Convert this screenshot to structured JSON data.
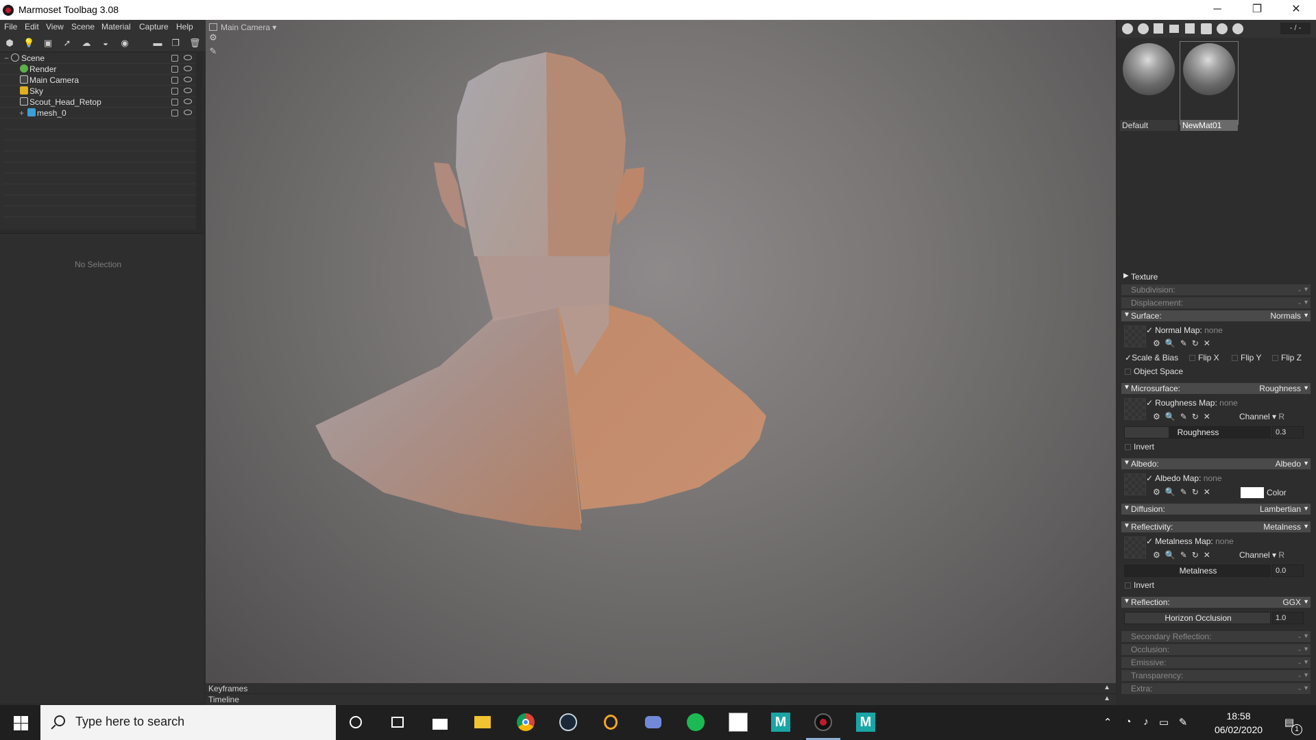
{
  "window": {
    "title": "Marmoset Toolbag 3.08",
    "minimize": "─",
    "maximize": "❐",
    "close": "✕"
  },
  "menu": [
    "File",
    "Edit",
    "View",
    "Scene",
    "Material",
    "Capture",
    "Help"
  ],
  "outliner": {
    "items": [
      {
        "label": "Scene",
        "expander": "−"
      },
      {
        "label": "Render"
      },
      {
        "label": "Main Camera"
      },
      {
        "label": "Sky"
      },
      {
        "label": "Scout_Head_Retop"
      },
      {
        "label": "mesh_0",
        "expander": "+"
      }
    ]
  },
  "properties": {
    "empty_text": "No Selection"
  },
  "viewport": {
    "camera": "Main Camera"
  },
  "timeline": {
    "keyframes": "Keyframes",
    "timeline": "Timeline"
  },
  "materials": {
    "counter": "- / -",
    "items": [
      {
        "name": "Default",
        "selected": false
      },
      {
        "name": "NewMat01",
        "selected": true
      }
    ]
  },
  "material_editor": {
    "texture": "Texture",
    "subdivision": {
      "label": "Subdivision:",
      "value": "-"
    },
    "displacement": {
      "label": "Displacement:",
      "value": "-"
    },
    "surface": {
      "label": "Surface:",
      "value": "Normals",
      "map_label": "Normal Map:",
      "map_value": "none",
      "scale_bias": "Scale & Bias",
      "flip_x": "Flip X",
      "flip_y": "Flip Y",
      "flip_z": "Flip Z",
      "object_space": "Object Space"
    },
    "microsurface": {
      "label": "Microsurface:",
      "value": "Roughness",
      "map_label": "Roughness Map:",
      "map_value": "none",
      "channel_label": "Channel",
      "channel_value": "R",
      "slider_label": "Roughness",
      "slider_value": "0.3",
      "slider_fraction": 0.3,
      "invert": "Invert"
    },
    "albedo": {
      "label": "Albedo:",
      "value": "Albedo",
      "map_label": "Albedo Map:",
      "map_value": "none",
      "color_label": "Color",
      "color": "#ffffff"
    },
    "diffusion": {
      "label": "Diffusion:",
      "value": "Lambertian"
    },
    "reflectivity": {
      "label": "Reflectivity:",
      "value": "Metalness",
      "map_label": "Metalness Map:",
      "map_value": "none",
      "channel_label": "Channel",
      "channel_value": "R",
      "slider_label": "Metalness",
      "slider_value": "0.0",
      "slider_fraction": 0.0,
      "invert": "Invert"
    },
    "reflection": {
      "label": "Reflection:",
      "value": "GGX",
      "slider_label": "Horizon Occlusion",
      "slider_value": "1.0",
      "slider_fraction": 1.0
    },
    "secondary_reflection": {
      "label": "Secondary Reflection:",
      "value": "-"
    },
    "occlusion": {
      "label": "Occlusion:",
      "value": "-"
    },
    "emissive": {
      "label": "Emissive:",
      "value": "-"
    },
    "transparency": {
      "label": "Transparency:",
      "value": "-"
    },
    "extra": {
      "label": "Extra:",
      "value": "-"
    }
  },
  "taskbar": {
    "search_placeholder": "Type here to search",
    "apps": [
      "cortana-icon",
      "task-view-icon",
      "store-icon",
      "file-explorer-icon",
      "chrome-icon",
      "steam-icon",
      "grammarly-icon",
      "discord-icon",
      "spotify-icon",
      "zbrush-icon",
      "maya-icon",
      "marmoset-icon",
      "maya-icon-2"
    ],
    "time": "18:58",
    "date": "06/02/2020",
    "notification_count": "1"
  },
  "colors": {
    "accent": "#8fb1d6",
    "panel": "#2d2d2d",
    "skin": "#c08c6f"
  }
}
